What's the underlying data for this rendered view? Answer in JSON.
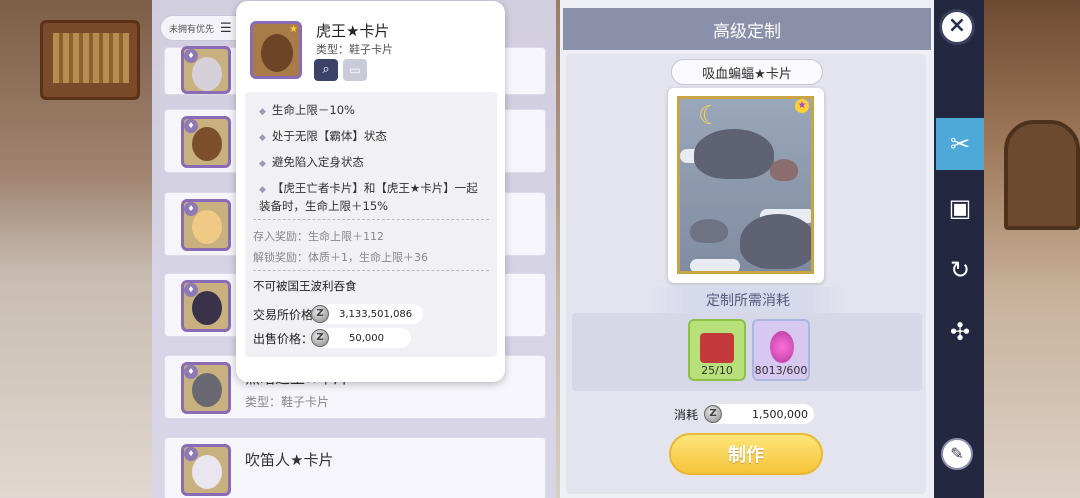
{
  "filter": {
    "label": "未拥有优先",
    "icon": "sort-icon"
  },
  "list": {
    "items": [
      {
        "name": "",
        "type": "",
        "accent": "#c9b07f"
      },
      {
        "name": "",
        "type": "",
        "accent": "#a9733f"
      },
      {
        "name": "",
        "type": "",
        "accent": "#e7c27a"
      },
      {
        "name": "",
        "type": "",
        "accent": "#3e3550"
      },
      {
        "name": "黑暗之王★卡片",
        "type": "类型：鞋子卡片",
        "accent": "#5b5a63"
      },
      {
        "name": "吹笛人★卡片",
        "type": "",
        "accent": "#6a4a7b"
      }
    ]
  },
  "popup": {
    "title": "虎王★卡片",
    "type": "类型：鞋子卡片",
    "effects": [
      "生命上限－10%",
      "处于无限【霸体】状态",
      "避免陷入定身状态",
      "【虎王亡者卡片】和【虎王★卡片】一起装备时，生命上限＋15%"
    ],
    "deposit_reward": "存入奖励：生命上限＋112",
    "unlock_reward": "解锁奖励：体质＋1，生命上限＋36",
    "non_trade": "不可被国王波利吞食",
    "exchange_label": "交易所价格：",
    "exchange_price": "3,133,501,086",
    "sell_label": "出售价格：",
    "sell_price": "50,000"
  },
  "craft": {
    "header": "高级定制",
    "card_name": "吸血蝙蝠★卡片",
    "cost_title": "定制所需消耗",
    "materials": [
      {
        "name": "material-chest",
        "count": "25/10",
        "color": "#b7e07a"
      },
      {
        "name": "material-crystal",
        "count": "8013/600",
        "color": "#d6c8ee"
      }
    ],
    "consume_label": "消耗",
    "consume_value": "1,500,000",
    "make_label": "制作"
  },
  "sidebar": {
    "close": "×",
    "tabs": [
      {
        "name": "tab-card-craft",
        "icon": "✂",
        "active": true
      },
      {
        "name": "tab-card-album",
        "icon": "▣",
        "active": false
      },
      {
        "name": "tab-card-refresh",
        "icon": "↻",
        "active": false
      },
      {
        "name": "tab-card-network",
        "icon": "✣",
        "active": false
      }
    ],
    "wand": "✎"
  }
}
